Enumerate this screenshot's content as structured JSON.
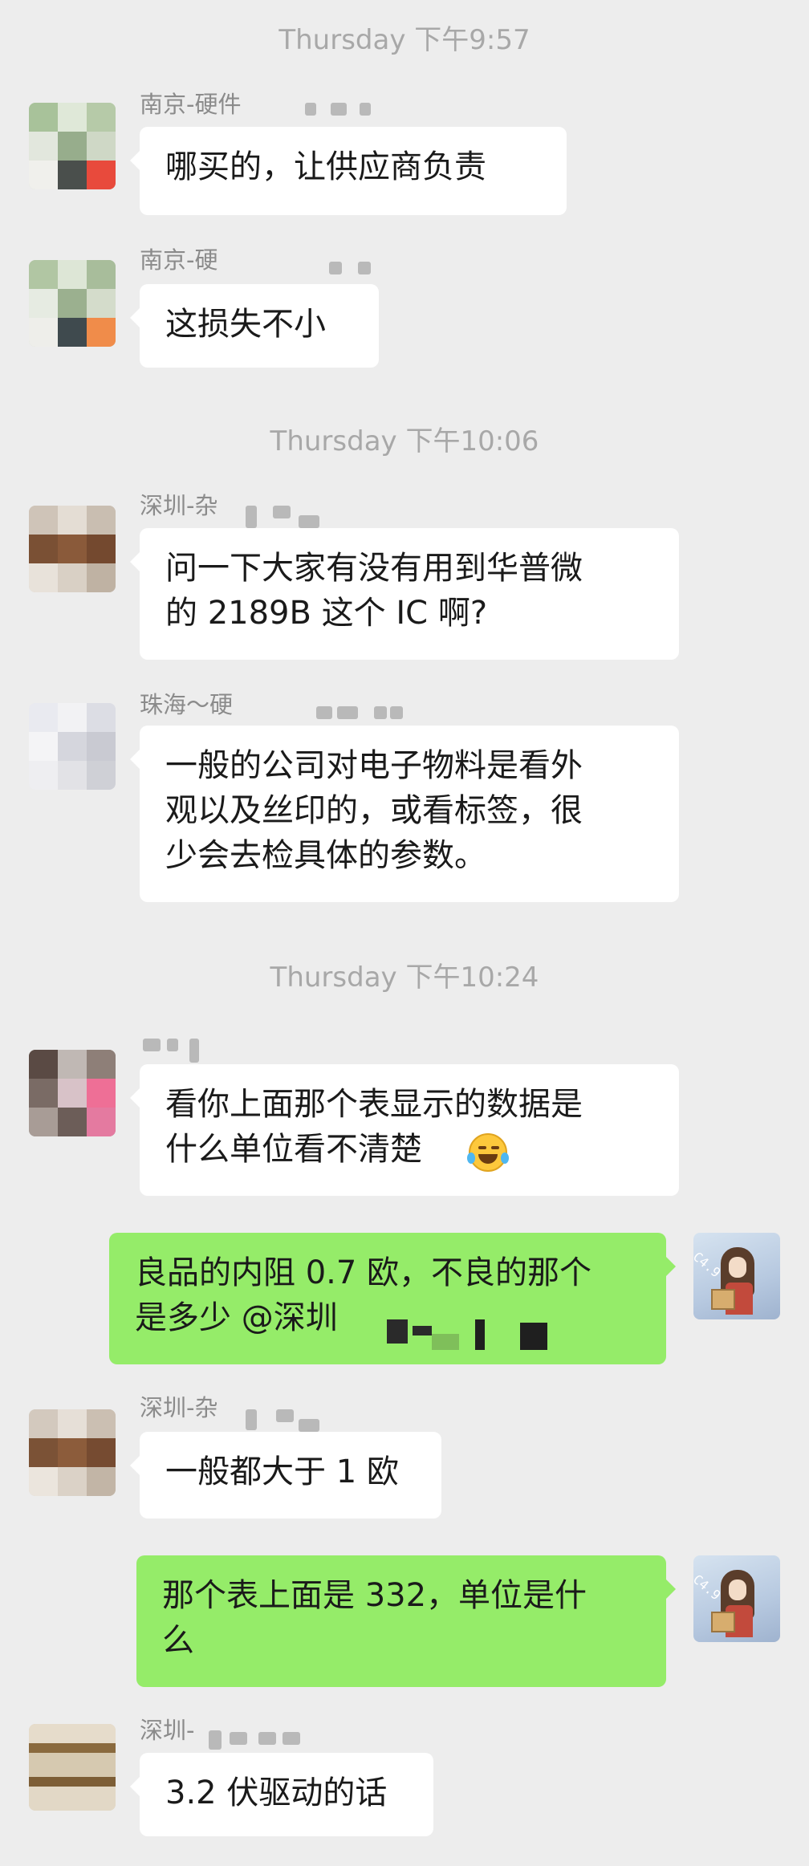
{
  "timestamps": [
    "Thursday 下午9:57",
    "Thursday 下午10:06",
    "Thursday 下午10:24"
  ],
  "messages": [
    {
      "sender": "南京-硬件",
      "text": "哪买的，让供应商负责"
    },
    {
      "sender": "南京-硬",
      "text": "这损失不小"
    },
    {
      "sender": "深圳-杂",
      "text": "问一下大家有没有用到华普微\n的 2189B 这个 IC 啊?"
    },
    {
      "sender": "珠海～硬",
      "text": "一般的公司对电子物料是看外\n观以及丝印的，或看标签，很\n少会去检具体的参数。"
    },
    {
      "sender": "",
      "text": "看你上面那个表显示的数据是\n什么单位看不清楚"
    },
    {
      "sender": "",
      "text": "良品的内阻 0.7 欧，不良的那个\n是多少 @深圳"
    },
    {
      "sender": "深圳-杂",
      "text": "一般都大于 1 欧"
    },
    {
      "sender": "",
      "text": "那个表上面是 332，单位是什\n么"
    },
    {
      "sender": "深圳-",
      "text": "3.2 伏驱动的话"
    }
  ],
  "self_avatar_tag": "C4.9",
  "colors": {
    "background": "#ededed",
    "bubble_in": "#ffffff",
    "bubble_out": "#95ec69",
    "timestamp_text": "#a8a8a8",
    "name_text": "#8b8b8b"
  },
  "icons": [
    "face-with-tears-of-joy-emoji"
  ]
}
